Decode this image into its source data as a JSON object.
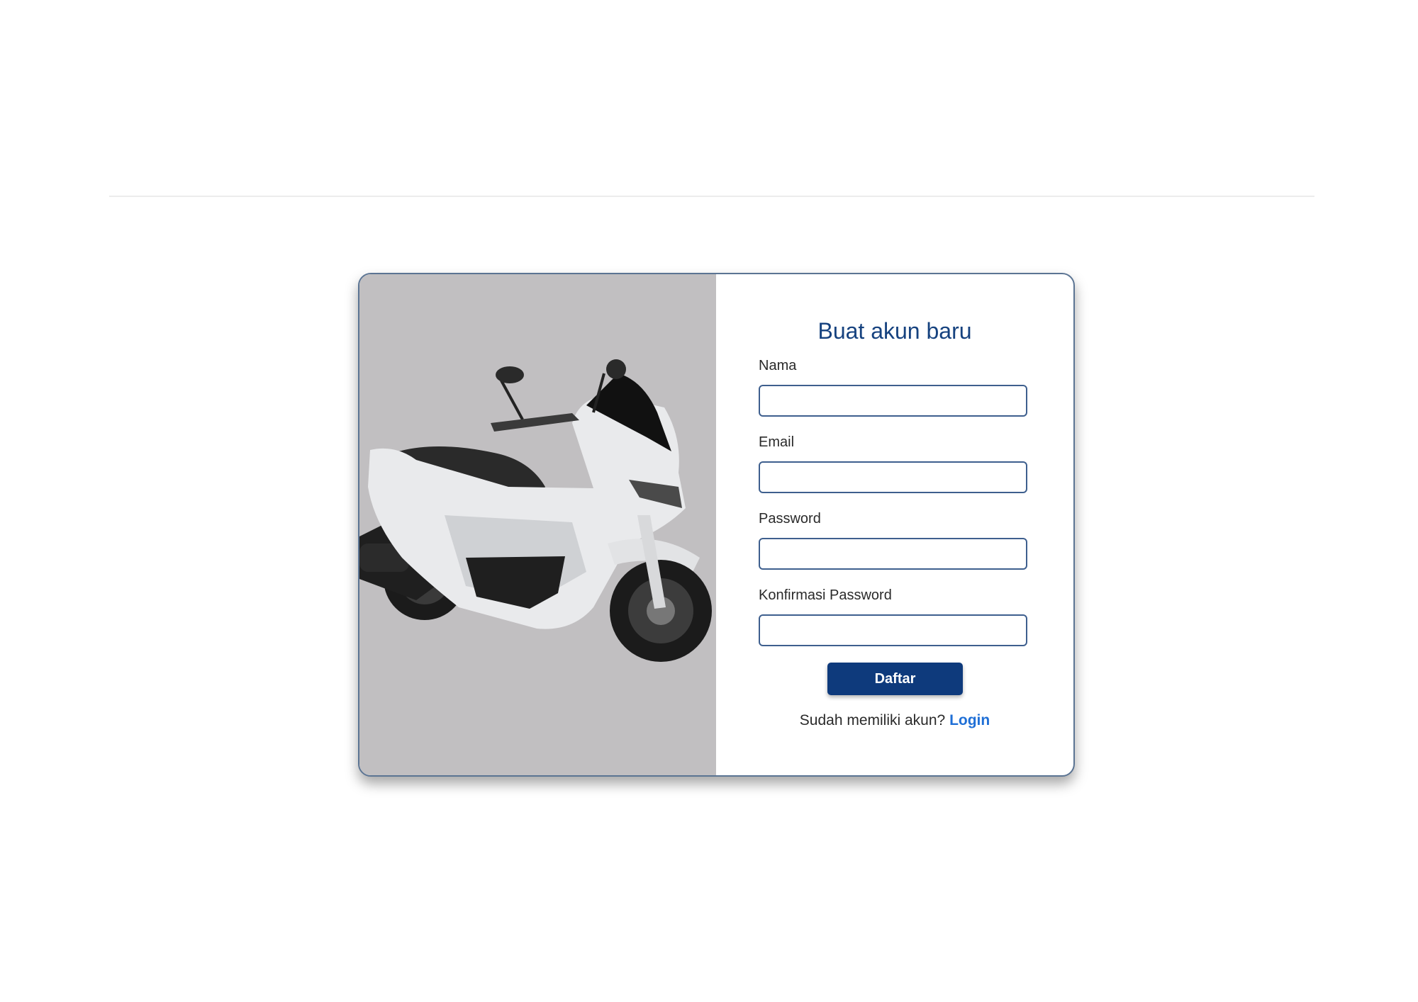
{
  "register": {
    "title": "Buat akun baru",
    "fields": [
      {
        "label": "Nama",
        "value": "",
        "placeholder": ""
      },
      {
        "label": "Email",
        "value": "",
        "placeholder": ""
      },
      {
        "label": "Password",
        "value": "",
        "placeholder": ""
      },
      {
        "label": "Konfirmasi Password",
        "value": "",
        "placeholder": ""
      }
    ],
    "submit_label": "Daftar",
    "login_prompt": "Sudah memiliki akun?",
    "login_link": "Login"
  },
  "colors": {
    "brand": "#0e3a7c",
    "title": "#16427f",
    "link": "#1f6fd6",
    "image_bg": "#c1bfc1"
  },
  "icons": {
    "hero_image": "scooter-image"
  }
}
